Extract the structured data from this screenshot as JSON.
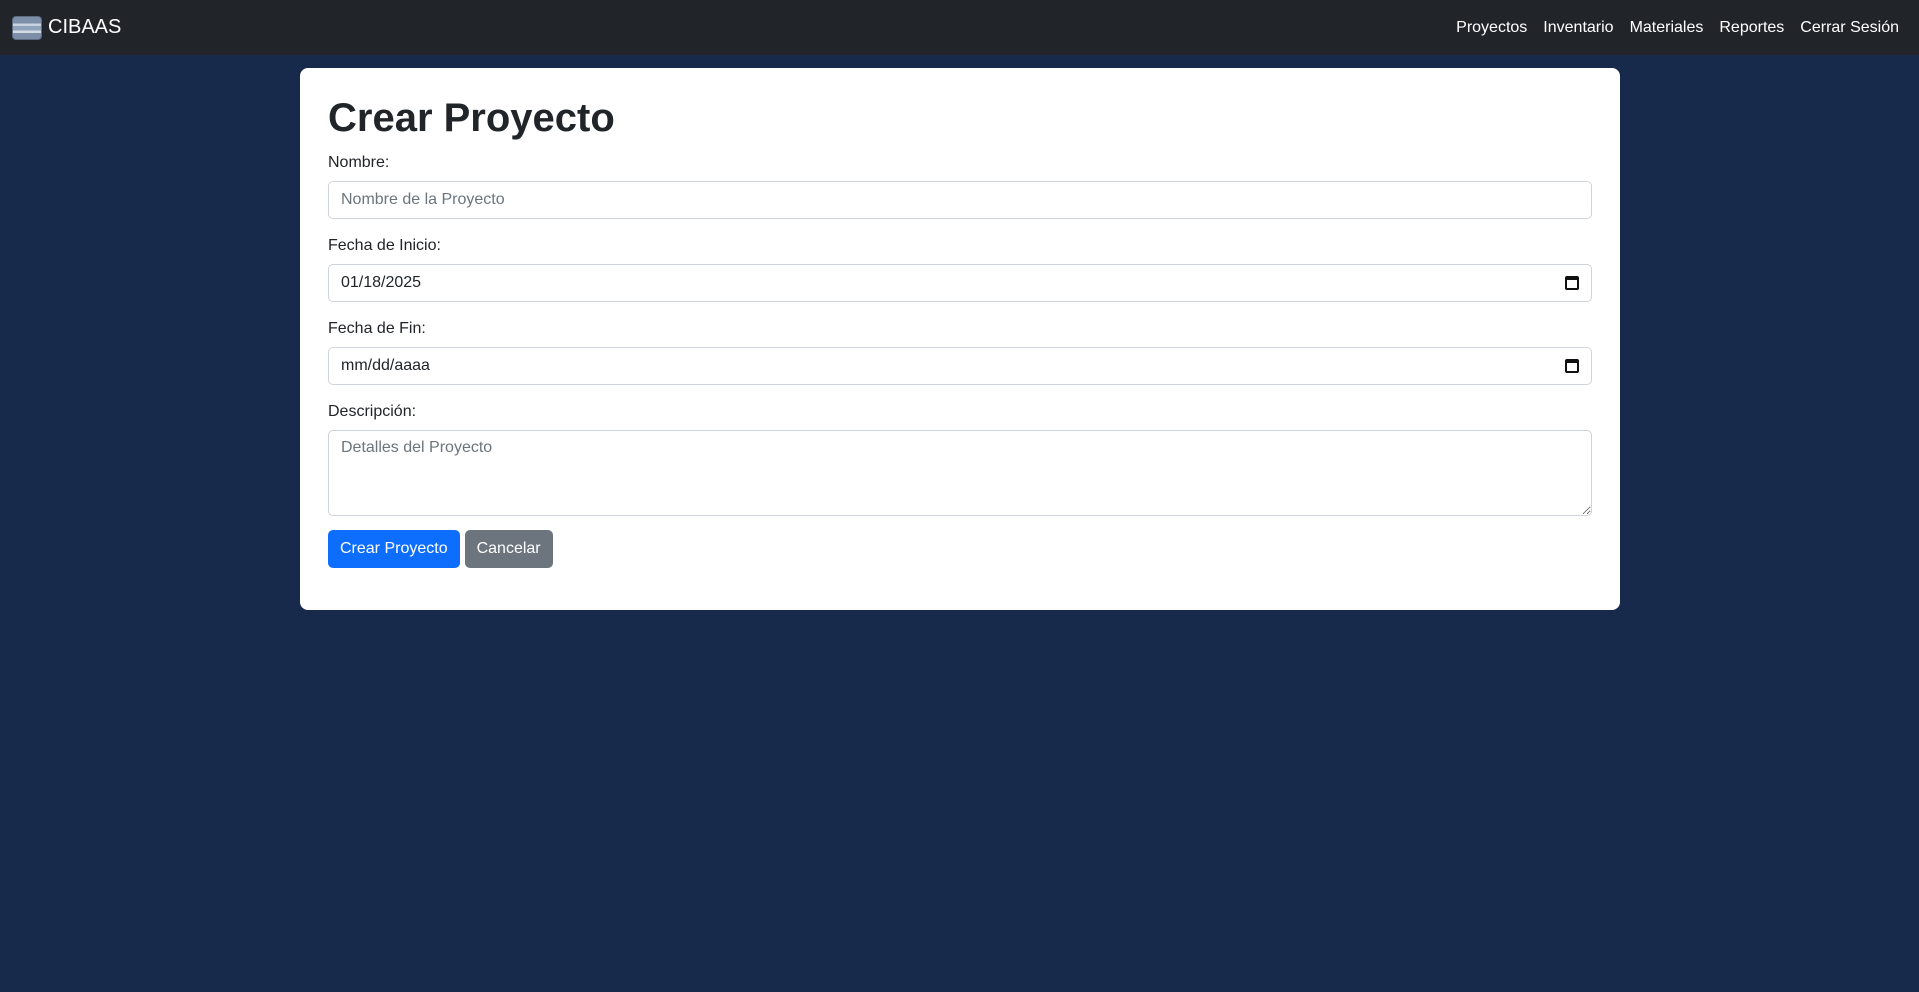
{
  "navbar": {
    "brand": "CIBAAS",
    "links": [
      "Proyectos",
      "Inventario",
      "Materiales",
      "Reportes",
      "Cerrar Sesión"
    ]
  },
  "form": {
    "title": "Crear Proyecto",
    "nombre": {
      "label": "Nombre:",
      "value": "",
      "placeholder": "Nombre de la Proyecto"
    },
    "fecha_inicio": {
      "label": "Fecha de Inicio:",
      "value": "01/18/2025"
    },
    "fecha_fin": {
      "label": "Fecha de Fin:",
      "value": "mm/dd/aaaa"
    },
    "descripcion": {
      "label": "Descripción:",
      "value": "",
      "placeholder": "Detalles del Proyecto"
    },
    "submit_label": "Crear Proyecto",
    "cancel_label": "Cancelar"
  },
  "colors": {
    "page_bg": "#172a4c",
    "navbar_bg": "#212529",
    "primary": "#0d6efd",
    "secondary": "#6c757d"
  }
}
